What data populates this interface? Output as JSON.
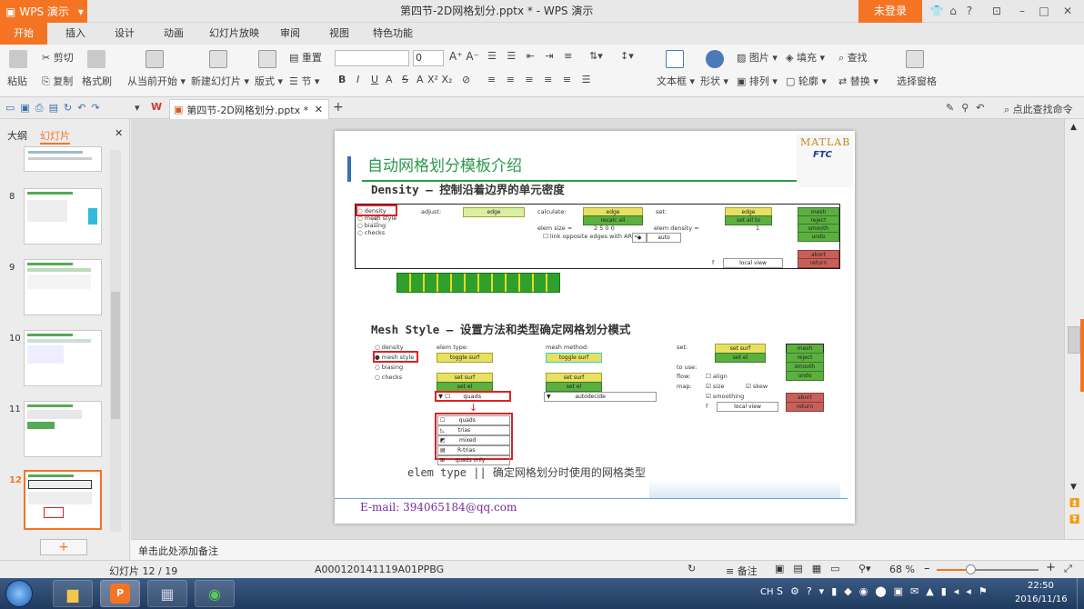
{
  "window": {
    "app_button": "WPS 演示",
    "doc_title": "第四节-2D网格划分.pptx * - WPS 演示",
    "login": "未登录"
  },
  "menu_tabs": [
    "开始",
    "插入",
    "设计",
    "动画",
    "幻灯片放映",
    "审阅",
    "视图",
    "特色功能"
  ],
  "ribbon": {
    "paste": "粘贴",
    "cut": "剪切",
    "copy": "复制",
    "format_painter": "格式刷",
    "from_current": "从当前开始",
    "new_slide": "新建幻灯片",
    "layout": "版式",
    "reset": "重置",
    "section": "节",
    "font_size": "0",
    "textbox": "文本框",
    "shape": "形状",
    "image": "图片",
    "fill": "填充",
    "arrange": "排列",
    "outline": "轮廓",
    "find": "查找",
    "replace": "替换",
    "select_pane": "选择窗格"
  },
  "qbar": {
    "doc_tab": "第四节-2D网格划分.pptx *",
    "search_cmd": "点此查找命令"
  },
  "left_panel": {
    "tab_outline": "大纲",
    "tab_slides": "幻灯片",
    "slide_numbers": [
      "8",
      "9",
      "10",
      "11",
      "12"
    ]
  },
  "slide": {
    "title": "自动网格划分模板介绍",
    "section1_heading": "Density  –  控制沿着边界的单元密度",
    "section2_heading": "Mesh Style  –  设置方法和类型确定网格划分模式",
    "elem_type_caption": "elem type  ||  确定网格划分时使用的网格类型",
    "email": "E-mail: 394065184@qq.com",
    "logo_text": "MATLAB",
    "logo_sub": "FTC",
    "panel1": {
      "radios": [
        "density",
        "mesh style",
        "biasing",
        "checks"
      ],
      "adjust": "adjust:",
      "edge": "edge",
      "calculate": "calculate:",
      "edge2": "edge",
      "recalc_all": "recalc all",
      "set": "set:",
      "edge3": "edge",
      "set_all_to": "set all to",
      "elem_size": "elem size =",
      "elem_size_val": "2  5  0  0",
      "elem_density": "elem density =",
      "density_val": "1",
      "link": "link opposite edges with AR <",
      "auto": "auto",
      "local_view": "local view",
      "f": "f",
      "mesh": "mesh",
      "reject": "reject",
      "smooth": "smooth",
      "undo": "undo",
      "abort": "abort",
      "return": "return"
    },
    "panel2": {
      "radios": [
        "density",
        "mesh style",
        "biasing",
        "checks"
      ],
      "elem_type": "elem type:",
      "toggle_surf": "toggle surf",
      "mesh_method": "mesh method:",
      "toggle_surf2": "toggle surf",
      "set_surf": "set surf",
      "set_el": "set el",
      "set_surf2": "set surf",
      "set_el2": "set el",
      "quads": "quads",
      "autodecide": "autodecide",
      "set": "set:",
      "set_surf3": "set surf",
      "set_el3": "set el",
      "to_use": "to use:",
      "flow": "flow:",
      "align": "align",
      "map": "map:",
      "size": "size",
      "skew": "skew",
      "smoothing": "smoothing",
      "local_view": "local view",
      "f": "f",
      "mesh": "mesh",
      "reject": "reject",
      "smooth": "smooth",
      "undo": "undo",
      "abort": "abort",
      "return": "return",
      "dropdown_items": [
        "quads",
        "trias",
        "mixed",
        "R-trias",
        "quads only"
      ]
    }
  },
  "notes_placeholder": "单击此处添加备注",
  "status": {
    "slide_count": "幻灯片 12 / 19",
    "template": "A000120141119A01PPBG",
    "notes": "备注",
    "zoom": "68 %"
  },
  "taskbar": {
    "lang": "CH",
    "time": "22:50",
    "date": "2016/11/16"
  }
}
